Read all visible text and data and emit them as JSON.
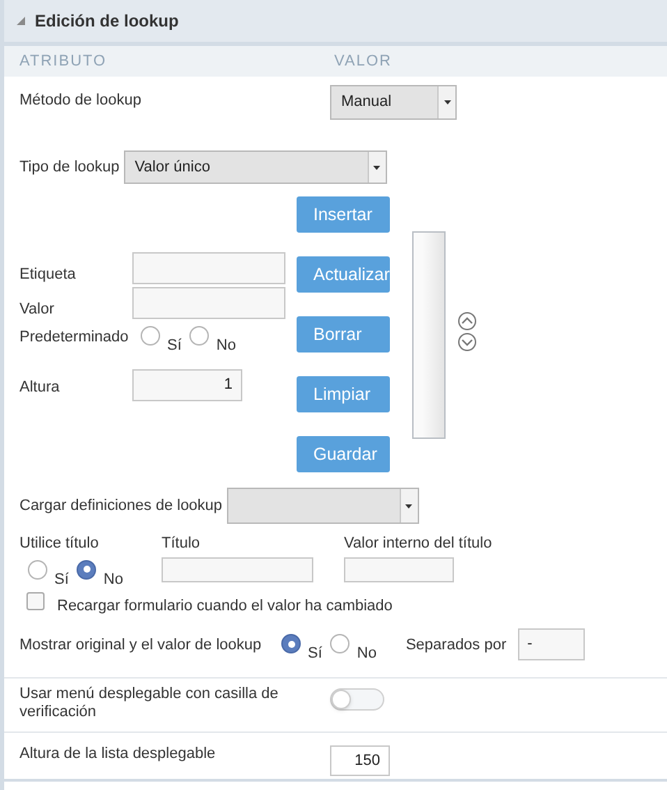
{
  "panel": {
    "title": "Edición de lookup",
    "expanded": true
  },
  "columns": [
    "ATRIBUTO",
    "VALOR"
  ],
  "lookup_method": {
    "label": "Método de lookup",
    "value": "Manual"
  },
  "lookup_type": {
    "label": "Tipo de lookup",
    "value": "Valor único"
  },
  "fields": [
    {
      "kind": "text",
      "label": "Etiqueta"
    },
    {
      "kind": "text",
      "label": "Valor"
    },
    {
      "kind": "radio",
      "label": "Predeterminado",
      "options": [
        {
          "label": "Sí",
          "selected": false
        },
        {
          "label": "No",
          "selected": false
        }
      ]
    },
    {
      "kind": "number",
      "label": "Altura",
      "value": "1"
    }
  ],
  "buttons": [
    "Insertar",
    "Actualizar",
    "Borrar",
    "Limpiar",
    "Guardar"
  ],
  "load_definitions": {
    "label": "Cargar definiciones de lookup"
  },
  "use_title": {
    "label": "Utilice título",
    "options": [
      {
        "label": "Sí",
        "selected": false
      },
      {
        "label": "No",
        "selected": true
      }
    ]
  },
  "title_field": {
    "label": "Título"
  },
  "title_internal_value": {
    "label": "Valor interno del título"
  },
  "reload_form": {
    "label": "Recargar formulario cuando el valor ha cambiado",
    "checked": false
  },
  "show_original": {
    "label": "Mostrar original y el valor de lookup",
    "options": [
      {
        "label": "Sí",
        "selected": true
      },
      {
        "label": "No",
        "selected": false
      }
    ],
    "separator_label": "Separados por",
    "separator": "-"
  },
  "checkbox_dropdown": {
    "label": "Usar menú desplegable con casilla de verificación",
    "on": false
  },
  "dropdown_height": {
    "label": "Altura de la lista desplegable",
    "value": "150"
  }
}
